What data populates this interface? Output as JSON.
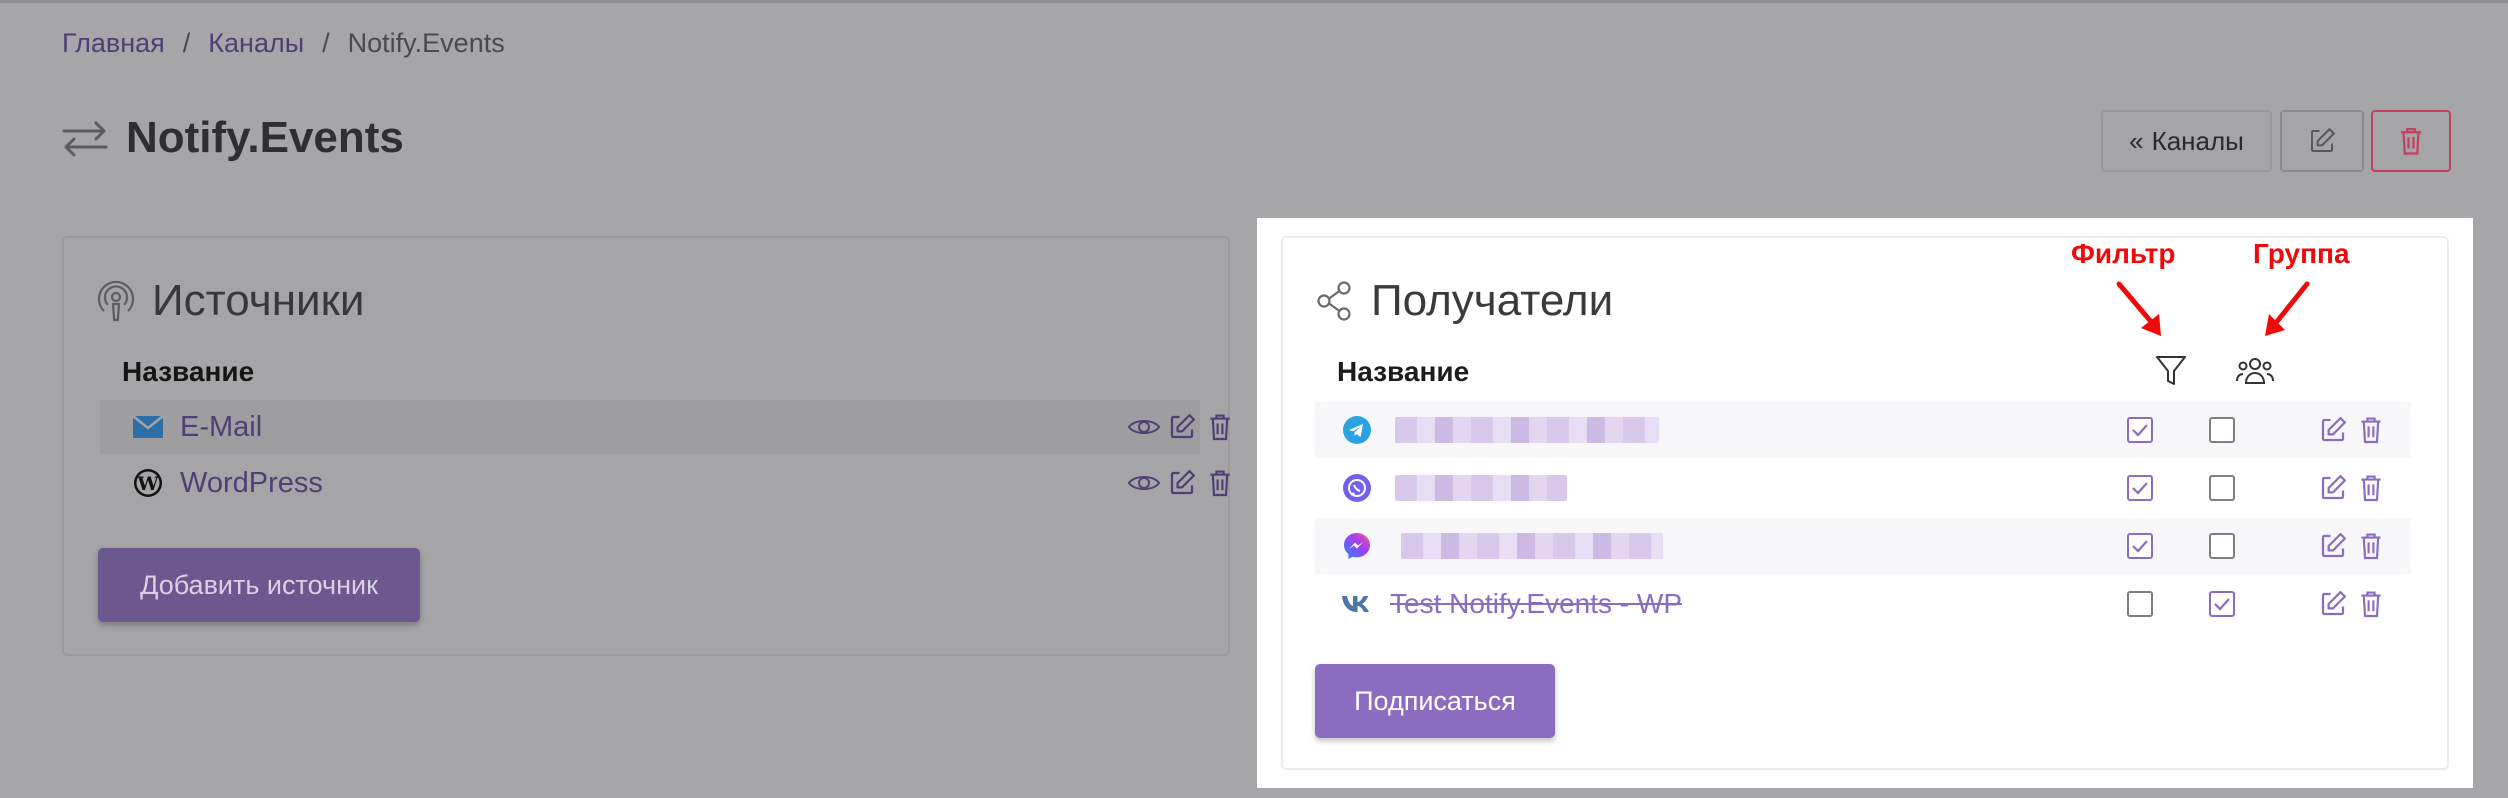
{
  "breadcrumb": {
    "items": [
      "Главная",
      "Каналы"
    ],
    "separator": "/",
    "current": "Notify.Events"
  },
  "page": {
    "title": "Notify.Events",
    "back_label": "Каналы"
  },
  "sources": {
    "title": "Источники",
    "column_name": "Название",
    "items": [
      {
        "name": "E-Mail",
        "icon": "mail-icon"
      },
      {
        "name": "WordPress",
        "icon": "wordpress-icon"
      }
    ],
    "add_label": "Добавить источник"
  },
  "recipients": {
    "title": "Получатели",
    "column_name": "Название",
    "annotations": {
      "filter": "Фильтр",
      "group": "Группа"
    },
    "items": [
      {
        "icon": "telegram-icon",
        "name": "",
        "filter": true,
        "group": false
      },
      {
        "icon": "viber-icon",
        "name": "",
        "filter": true,
        "group": false
      },
      {
        "icon": "messenger-icon",
        "name": "",
        "filter": true,
        "group": false
      },
      {
        "icon": "vk-icon",
        "name": "Test Notify.Events - WP",
        "filter": false,
        "group": true
      }
    ],
    "subscribe_label": "Подписаться"
  },
  "colors": {
    "accent": "#8a6cc0",
    "link": "#4f3f75",
    "danger": "#c24060",
    "annotation": "#ee0a0a",
    "telegram": "#2aa3e0",
    "viber": "#7360f2",
    "vk": "#4a76a8"
  }
}
